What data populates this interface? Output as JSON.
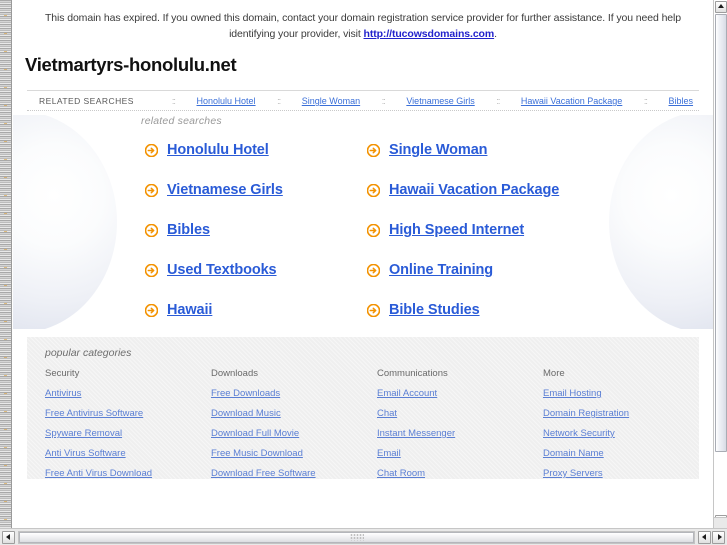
{
  "banner": {
    "text_before": "This domain has expired. If you owned this domain, contact your domain registration service provider for further assistance. If you need help identifying your provider, visit ",
    "link_text": "http://tucowsdomains.com",
    "text_after": "."
  },
  "domain": {
    "title": "Vietmartyrs-honolulu.net"
  },
  "related_strip": {
    "label": "RELATED SEARCHES",
    "separator": "::",
    "links": [
      "Honolulu Hotel",
      "Single Woman",
      "Vietnamese Girls",
      "Hawaii Vacation Package",
      "Bibles"
    ]
  },
  "hero": {
    "caption": "related searches",
    "links": [
      "Honolulu Hotel",
      "Single Woman",
      "Vietnamese Girls",
      "Hawaii Vacation Package",
      "Bibles",
      "High Speed Internet",
      "Used Textbooks",
      "Online Training",
      "Hawaii",
      "Bible Studies"
    ]
  },
  "categories": {
    "title": "popular categories",
    "columns": [
      {
        "heading": "Security",
        "links": [
          "Antivirus",
          "Free Antivirus Software",
          "Spyware Removal",
          "Anti Virus Software",
          "Free Anti Virus Download"
        ]
      },
      {
        "heading": "Downloads",
        "links": [
          "Free Downloads",
          "Download Music",
          "Download Full Movie",
          "Free Music Download",
          "Download Free Software"
        ]
      },
      {
        "heading": "Communications",
        "links": [
          "Email Account",
          "Chat",
          "Instant Messenger",
          "Email",
          "Chat Room"
        ]
      },
      {
        "heading": "More",
        "links": [
          "Email Hosting",
          "Domain Registration",
          "Network Security",
          "Domain Name",
          "Proxy Servers"
        ]
      }
    ]
  },
  "colors": {
    "link_blue": "#2a5bd7",
    "strip_link_blue": "#3a6fd8",
    "category_link_blue": "#5b7fd4",
    "banner_link_blue": "#2222cc",
    "arrow_orange": "#f39200",
    "category_bg": "#efefef"
  },
  "icons": {
    "arrow_circle": "arrow-circle-right-icon"
  }
}
